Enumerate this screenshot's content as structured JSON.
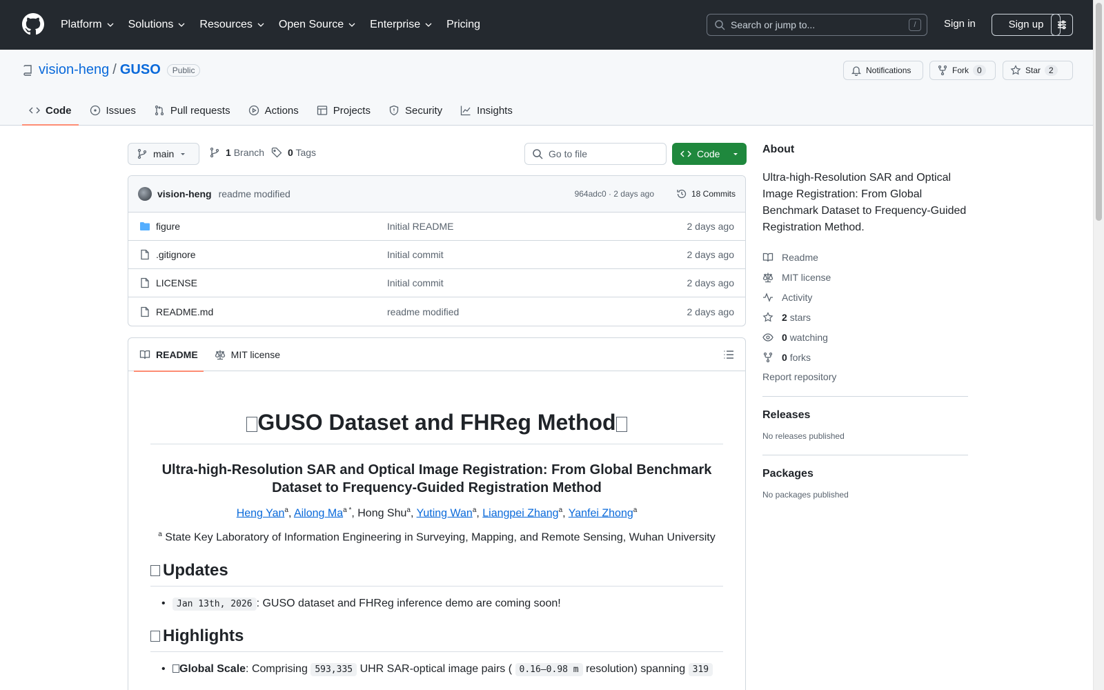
{
  "colors": {
    "header_bg": "#24292f",
    "link": "#0969da",
    "primary_btn": "#1f883d",
    "tab_underline": "#fd8c73"
  },
  "topnav": {
    "items": [
      "Platform",
      "Solutions",
      "Resources",
      "Open Source",
      "Enterprise",
      "Pricing"
    ],
    "search_placeholder": "Search or jump to...",
    "search_shortcut": "/",
    "signin": "Sign in",
    "signup": "Sign up"
  },
  "repo": {
    "owner": "vision-heng",
    "separator": "/",
    "name": "GUSO",
    "visibility": "Public",
    "notifications": "Notifications",
    "fork_label": "Fork",
    "fork_count": "0",
    "star_label": "Star",
    "star_count": "2"
  },
  "tabs": [
    "Code",
    "Issues",
    "Pull requests",
    "Actions",
    "Projects",
    "Security",
    "Insights"
  ],
  "branchbar": {
    "branch": "main",
    "branch_count": "1",
    "branch_label": "Branch",
    "tag_count": "0",
    "tag_label": "Tags",
    "goto_placeholder": "Go to file",
    "code_button": "Code"
  },
  "commit": {
    "author": "vision-heng",
    "message": "readme modified",
    "meta": "964adc0 · 2 days ago",
    "commits": "18 Commits"
  },
  "files": [
    {
      "name": "figure",
      "type": "folder",
      "message": "Initial README",
      "date": "2 days ago"
    },
    {
      "name": ".gitignore",
      "type": "file",
      "message": "Initial commit",
      "date": "2 days ago"
    },
    {
      "name": "LICENSE",
      "type": "file",
      "message": "Initial commit",
      "date": "2 days ago"
    },
    {
      "name": "README.md",
      "type": "file",
      "message": "readme modified",
      "date": "2 days ago"
    }
  ],
  "readme": {
    "tab_readme": "README",
    "tab_license": "MIT license",
    "title": "GUSO Dataset and FHReg Method",
    "subtitle": "Ultra-high-Resolution SAR and Optical Image Registration: From Global Benchmark Dataset to Frequency-Guided Registration Method",
    "authors": [
      {
        "name": "Heng Yan",
        "sup": "a",
        "link": true
      },
      {
        "name": "Ailong Ma",
        "sup": "a *",
        "link": true
      },
      {
        "name": "Hong Shu",
        "sup": "a",
        "link": false
      },
      {
        "name": "Yuting Wan",
        "sup": "a",
        "link": true
      },
      {
        "name": "Liangpei Zhang",
        "sup": "a",
        "link": true
      },
      {
        "name": "Yanfei Zhong",
        "sup": "a",
        "link": true
      }
    ],
    "affiliation_sup": "a",
    "affiliation": "State Key Laboratory of Information Engineering in Surveying, Mapping, and Remote Sensing, Wuhan University",
    "updates_heading": "Updates",
    "update_date": "Jan 13th, 2026",
    "update_text": ": GUSO dataset and FHReg inference demo are coming soon!",
    "highlights_heading": "Highlights",
    "hl_bold": "Global Scale",
    "hl_text1": ": Comprising",
    "hl_code1": "593,335",
    "hl_text2": "UHR SAR-optical image pairs (",
    "hl_code2": "0.16–0.98 m",
    "hl_text3": "resolution) spanning",
    "hl_code3": "319"
  },
  "about": {
    "heading": "About",
    "description": "Ultra-high-Resolution SAR and Optical Image Registration: From Global Benchmark Dataset to Frequency-Guided Registration Method.",
    "readme": "Readme",
    "license": "MIT license",
    "activity": "Activity",
    "stars_count": "2",
    "stars_label": "stars",
    "watching_count": "0",
    "watching_label": "watching",
    "forks_count": "0",
    "forks_label": "forks",
    "report": "Report repository"
  },
  "releases": {
    "heading": "Releases",
    "text": "No releases published"
  },
  "packages": {
    "heading": "Packages",
    "text": "No packages published"
  }
}
